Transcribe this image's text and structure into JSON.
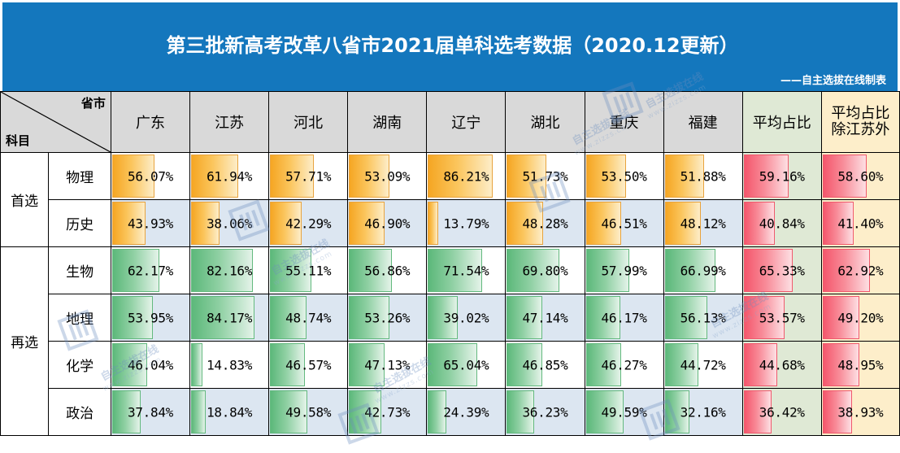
{
  "banner": {
    "title": "第三批新高考改革八省市2021届单科选考数据（2020.12更新）",
    "subtitle": "——自主选拔在线制表",
    "bg_color": "#1477bd"
  },
  "table": {
    "corner": {
      "column_axis_label": "省市",
      "row_axis_label": "科目"
    },
    "provinces": [
      "广东",
      "江苏",
      "河北",
      "湖南",
      "辽宁",
      "湖北",
      "重庆",
      "福建"
    ],
    "average_columns": [
      {
        "label": "平均占比",
        "bg_color": "#dfe9d5"
      },
      {
        "label": "平均占比除江苏外",
        "label_line1": "平均占比",
        "label_line2": "除江苏外",
        "bg_color": "#fdeeca"
      }
    ],
    "groups": [
      {
        "name": "首选",
        "bar_color": "#f5a623",
        "rows": [
          {
            "subject": "物理",
            "row_bg": "#ffffff",
            "values": [
              "56.07%",
              "61.94%",
              "57.71%",
              "53.09%",
              "86.21%",
              "51.73%",
              "53.50%",
              "51.88%"
            ],
            "numeric": [
              56.07,
              61.94,
              57.71,
              53.09,
              86.21,
              51.73,
              53.5,
              51.88
            ],
            "avg": "59.16%",
            "avg_numeric": 59.16,
            "avg_ex_jiangsu": "58.60%",
            "avg_ex_jiangsu_numeric": 58.6
          },
          {
            "subject": "历史",
            "row_bg": "#dce6f1",
            "values": [
              "43.93%",
              "38.06%",
              "42.29%",
              "46.90%",
              "13.79%",
              "48.28%",
              "46.51%",
              "48.12%"
            ],
            "numeric": [
              43.93,
              38.06,
              42.29,
              46.9,
              13.79,
              48.28,
              46.51,
              48.12
            ],
            "avg": "40.84%",
            "avg_numeric": 40.84,
            "avg_ex_jiangsu": "41.40%",
            "avg_ex_jiangsu_numeric": 41.4
          }
        ]
      },
      {
        "name": "再选",
        "bar_color": "#5cb87a",
        "rows": [
          {
            "subject": "生物",
            "row_bg": "#ffffff",
            "values": [
              "62.17%",
              "82.16%",
              "55.11%",
              "56.86%",
              "71.54%",
              "69.80%",
              "57.99%",
              "66.99%"
            ],
            "numeric": [
              62.17,
              82.16,
              55.11,
              56.86,
              71.54,
              69.8,
              57.99,
              66.99
            ],
            "avg": "65.33%",
            "avg_numeric": 65.33,
            "avg_ex_jiangsu": "62.92%",
            "avg_ex_jiangsu_numeric": 62.92
          },
          {
            "subject": "地理",
            "row_bg": "#dce6f1",
            "values": [
              "53.95%",
              "84.17%",
              "48.74%",
              "53.26%",
              "39.02%",
              "47.14%",
              "46.17%",
              "56.13%"
            ],
            "numeric": [
              53.95,
              84.17,
              48.74,
              53.26,
              39.02,
              47.14,
              46.17,
              56.13
            ],
            "avg": "53.57%",
            "avg_numeric": 53.57,
            "avg_ex_jiangsu": "49.20%",
            "avg_ex_jiangsu_numeric": 49.2
          },
          {
            "subject": "化学",
            "row_bg": "#ffffff",
            "values": [
              "46.04%",
              "14.83%",
              "46.57%",
              "47.13%",
              "65.04%",
              "46.85%",
              "46.27%",
              "44.72%"
            ],
            "numeric": [
              46.04,
              14.83,
              46.57,
              47.13,
              65.04,
              46.85,
              46.27,
              44.72
            ],
            "avg": "44.68%",
            "avg_numeric": 44.68,
            "avg_ex_jiangsu": "48.95%",
            "avg_ex_jiangsu_numeric": 48.95
          },
          {
            "subject": "政治",
            "row_bg": "#dce6f1",
            "values": [
              "37.84%",
              "18.84%",
              "49.58%",
              "42.73%",
              "24.39%",
              "36.23%",
              "49.59%",
              "32.16%"
            ],
            "numeric": [
              37.84,
              18.84,
              49.58,
              42.73,
              24.39,
              36.23,
              49.59,
              32.16
            ],
            "avg": "36.42%",
            "avg_numeric": 36.42,
            "avg_ex_jiangsu": "38.93%",
            "avg_ex_jiangsu_numeric": 38.93
          }
        ]
      }
    ]
  },
  "watermarks": {
    "text": "自主选拔在线",
    "url": "www.zizzs.com",
    "logo": "zizzs-logo"
  }
}
